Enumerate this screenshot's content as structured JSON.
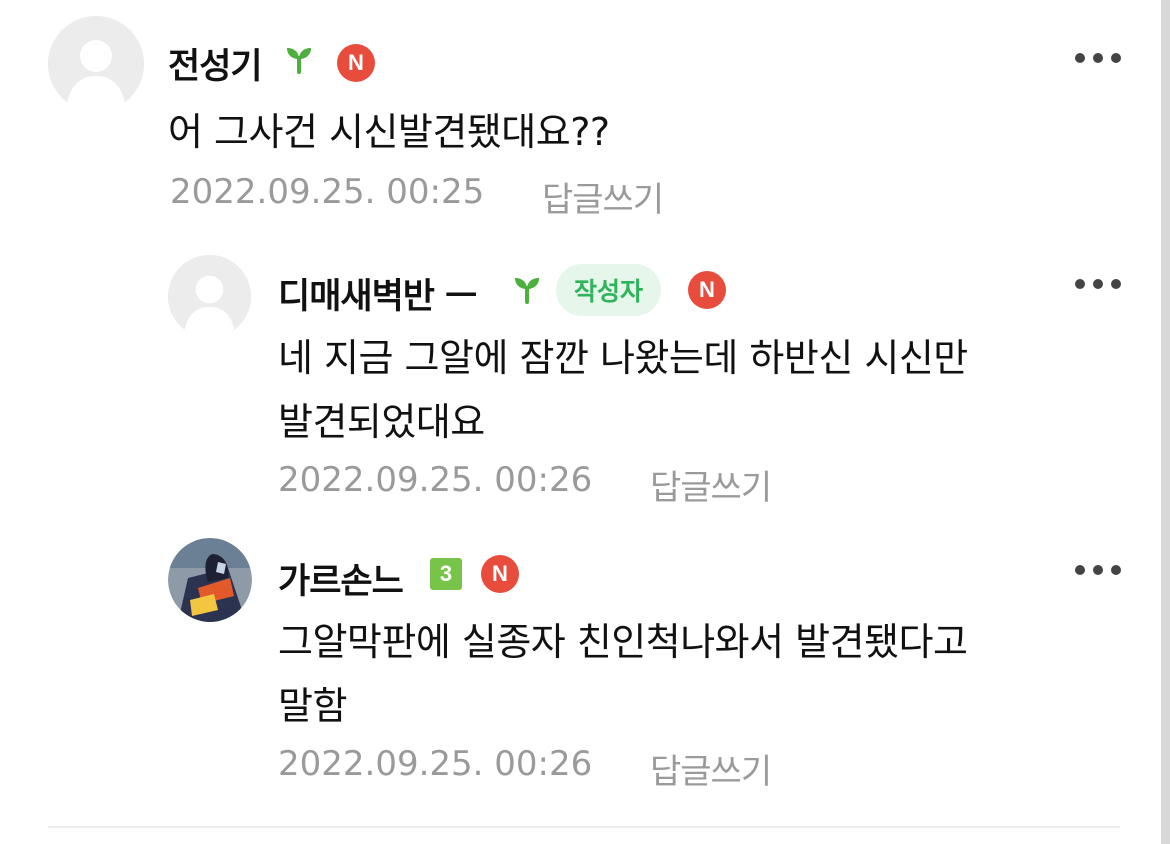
{
  "colors": {
    "new_badge": "#e84c3d",
    "author_badge_bg": "#e6f6ea",
    "author_badge_text": "#2fb35b",
    "sprout": "#4caf3e",
    "level_badge": "#78c449",
    "meta_text": "#9a9a9a"
  },
  "comments": [
    {
      "nickname": "전성기",
      "grade_icon": "sprout-icon",
      "new_badge": "N",
      "text_lines": [
        "어 그사건 시신발견됐대요??"
      ],
      "date": "2022.09.25. 00:25",
      "reply_label": "답글쓰기"
    },
    {
      "nickname": "디매새벽반 ㅡ",
      "grade_icon": "sprout-icon",
      "author_badge": "작성자",
      "new_badge": "N",
      "text_lines": [
        "네 지금 그알에 잠깐 나왔는데 하반신 시신만",
        "발견되었대요"
      ],
      "date": "2022.09.25. 00:26",
      "reply_label": "답글쓰기"
    },
    {
      "nickname": "가르손느",
      "grade_icon": "level-3-icon",
      "level": "3",
      "new_badge": "N",
      "text_lines": [
        "그알막판에 실종자 친인척나와서 발견됐다고",
        "말함"
      ],
      "date": "2022.09.25. 00:26",
      "reply_label": "답글쓰기"
    }
  ]
}
